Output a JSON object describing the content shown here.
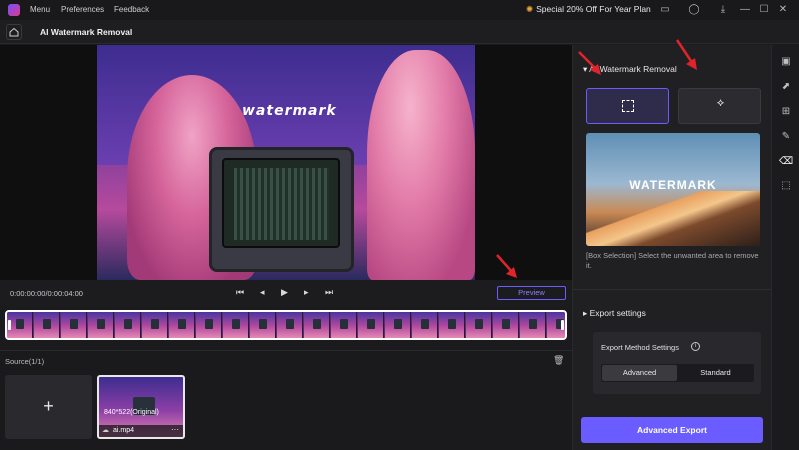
{
  "titlebar": {
    "menus": [
      "Menu",
      "Preferences",
      "Feedback"
    ],
    "promo": "Special 20% Off For Year Plan",
    "icons": [
      "tag-icon",
      "user-icon",
      "download-icon",
      "minimize-icon",
      "maximize-icon",
      "close-icon"
    ]
  },
  "subbar": {
    "title": "AI Watermark Removal"
  },
  "player": {
    "time": "0:00:00:00/0:00:04:00",
    "preview_label": "Preview",
    "watermark_text": "watermark"
  },
  "source": {
    "label": "Source(1/1)",
    "add_symbol": "+",
    "clip": {
      "resolution": "840*522(Original)",
      "file_name": "ai.mp4"
    }
  },
  "panel": {
    "section_title": "AI Watermark Removal",
    "example_text": "WATERMARK",
    "description": "[Box Selection] Select the unwanted area to remove it.",
    "export_title": "Export settings",
    "method_label": "Export Method Settings",
    "methods": [
      "Advanced",
      "Standard"
    ],
    "selected_method": "Advanced",
    "export_button": "Advanced Export"
  },
  "rail": {
    "icons": [
      "video-icon",
      "edit-icon",
      "grid-icon",
      "pen-icon",
      "eraser-icon",
      "select-icon"
    ]
  },
  "colors": {
    "accent": "#6b5cff",
    "arrow": "#e0242b"
  }
}
